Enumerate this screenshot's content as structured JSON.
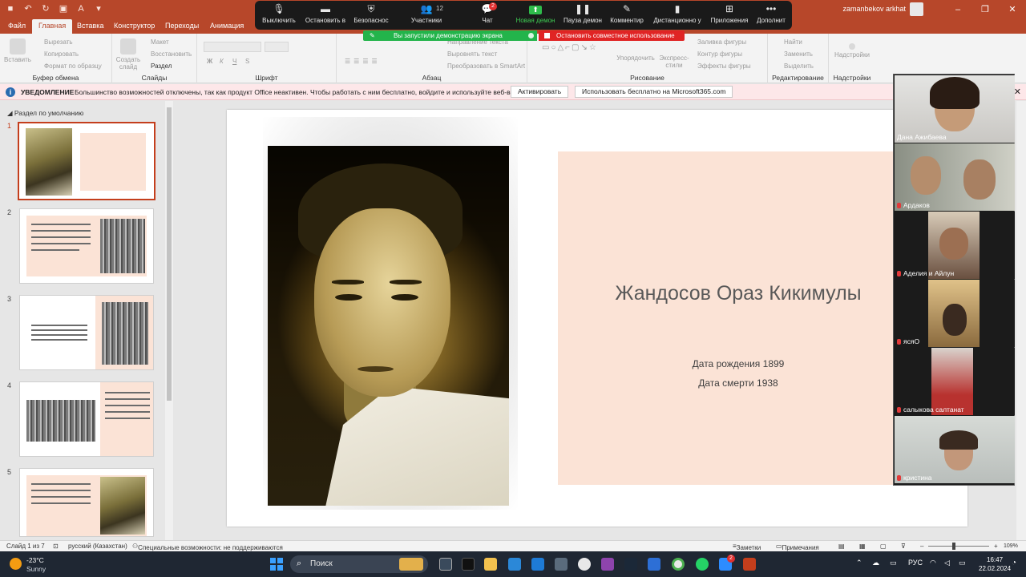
{
  "window": {
    "user": "zamanbekov arkhat"
  },
  "menu_tabs": [
    "Файл",
    "Главная",
    "Вставка",
    "Конструктор",
    "Переходы",
    "Анимация"
  ],
  "ribbon": {
    "clipboard": {
      "paste": "Вставить",
      "cut": "Вырезать",
      "copy": "Копировать",
      "format_painter": "Формат по образцу",
      "label": "Буфер обмена"
    },
    "slides": {
      "create": "Создать слайд",
      "layout": "Макет",
      "reset": "Восстановить",
      "section": "Раздел",
      "label": "Слайды"
    },
    "font": {
      "bold": "Ж",
      "italic": "К",
      "underline": "Ч",
      "strike": "S",
      "label": "Шрифт"
    },
    "paragraph": {
      "direction": "Направление текста",
      "align": "Выровнять текст",
      "smartart": "Преобразовать в SmartArt",
      "label": "Абзац"
    },
    "drawing": {
      "arrange": "Упорядочить",
      "quick_styles": "Экспресс-стили",
      "fill": "Заливка фигуры",
      "outline": "Контур фигуры",
      "effects": "Эффекты фигуры",
      "label": "Рисование"
    },
    "editing": {
      "find": "Найти",
      "replace": "Заменить",
      "select": "Выделить",
      "label": "Редактирование"
    },
    "addins": {
      "label": "Надстройки",
      "button": "Надстройки"
    }
  },
  "zoom_toolbar": {
    "buttons": [
      "Выключить",
      "Остановить в",
      "Безопаснос",
      "Участники",
      "Чат",
      "Новая демон",
      "Пауза демон",
      "Комментир",
      "Дистанционно у",
      "Приложения",
      "Дополнит"
    ],
    "participants_count": "12",
    "chat_badge": "2",
    "sharing_text": "Вы запустили демонстрацию экрана",
    "stop_text": "Остановить совместное использование"
  },
  "notification": {
    "title": "УВЕДОМЛЕНИЕ",
    "message": "Большинство возможностей отключены, так как продукт Office неактивен. Чтобы работать с ним бесплатно, войдите и используйте веб-версию.",
    "activate": "Активировать",
    "free_web": "Использовать бесплатно на Microsoft365.com"
  },
  "thumbnails": {
    "section": "Раздел по умолчанию",
    "slides": [
      "1",
      "2",
      "3",
      "4",
      "5"
    ]
  },
  "slide": {
    "title": "Жандосов Ораз Кикимулы",
    "birth": "Дата рождения 1899",
    "death": "Дата смерти 1938"
  },
  "gallery": {
    "participants": [
      {
        "name": "Дана Ажибаева"
      },
      {
        "name": "Ардаков"
      },
      {
        "name": "Аделия и Айлун"
      },
      {
        "name": "ясяО"
      },
      {
        "name": "салыкова салтанат"
      },
      {
        "name": "кристина"
      }
    ]
  },
  "statusbar": {
    "slide_info": "Слайд 1 из 7",
    "language": "русский (Казахстан)",
    "accessibility": "Специальные возможности: не поддерживаются",
    "notes": "Заметки",
    "comments": "Примечания",
    "zoom": "109%"
  },
  "taskbar": {
    "temp": "-23°C",
    "weather": "Sunny",
    "search": "Поиск",
    "lang": "РУС",
    "time": "16:47",
    "date": "22.02.2024",
    "notif_badge": "2"
  },
  "colors": {
    "accent": "#b7472a",
    "peach": "#fbe3d6",
    "zoom_green": "#23b44b",
    "zoom_red": "#e02424"
  }
}
